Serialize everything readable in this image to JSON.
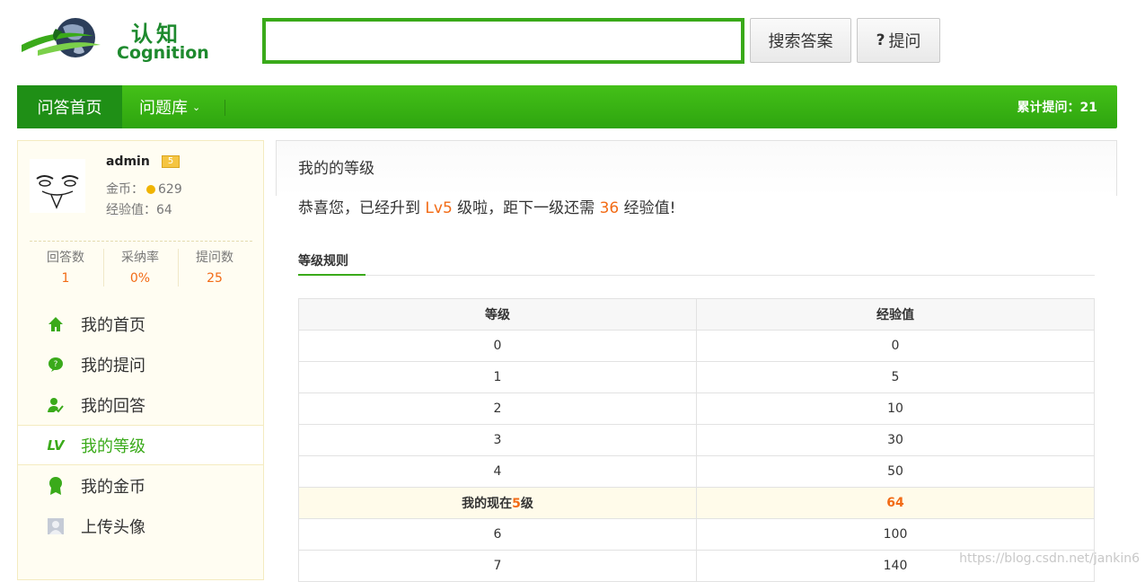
{
  "brand": {
    "name_cn": "认知",
    "name_en": "Cognition"
  },
  "search": {
    "placeholder": "",
    "search_label": "搜索答案",
    "ask_icon": "?",
    "ask_label": "提问"
  },
  "nav": {
    "home": "问答首页",
    "library": "问题库",
    "library_caret": "⌄",
    "stat_label": "累计提问：21"
  },
  "user": {
    "name": "admin",
    "level_badge": "5",
    "coins_label": "金币：",
    "coins": "629",
    "exp_label": "经验值：",
    "exp": "64",
    "stats": [
      {
        "label": "回答数",
        "value": "1"
      },
      {
        "label": "采纳率",
        "value": "0%"
      },
      {
        "label": "提问数",
        "value": "25"
      }
    ]
  },
  "menu": [
    {
      "label": "我的首页",
      "icon": "home-icon"
    },
    {
      "label": "我的提问",
      "icon": "question-bubble-icon"
    },
    {
      "label": "我的回答",
      "icon": "user-check-icon"
    },
    {
      "label": "我的等级",
      "icon": "level-icon",
      "icon_text": "LV"
    },
    {
      "label": "我的金币",
      "icon": "medal-icon"
    },
    {
      "label": "上传头像",
      "icon": "avatar-upload-icon"
    }
  ],
  "main": {
    "title": "我的的等级",
    "congrats_prefix": "恭喜您，已经升到 ",
    "current_level": "Lv5",
    "congrats_middle": " 级啦，距下一级还需 ",
    "exp_needed": "36",
    "congrats_suffix": " 经验值!",
    "tab_label": "等级规则",
    "table": {
      "headers": [
        "等级",
        "经验值"
      ],
      "rows": [
        [
          "0",
          "0"
        ],
        [
          "1",
          "5"
        ],
        [
          "2",
          "10"
        ],
        [
          "3",
          "30"
        ],
        [
          "4",
          "50"
        ],
        [
          "__current__",
          "64"
        ],
        [
          "6",
          "100"
        ],
        [
          "7",
          "140"
        ]
      ],
      "current_prefix": "我的现在",
      "current_level_num": "5",
      "current_suffix": "级"
    }
  },
  "watermark": "https://blog.csdn.net/jankin6",
  "colors": {
    "brand_green": "#3aaa1a",
    "nav_dark": "#1f8f16",
    "accent_orange": "#f26b16",
    "sidebar_bg": "#fffdf2"
  }
}
